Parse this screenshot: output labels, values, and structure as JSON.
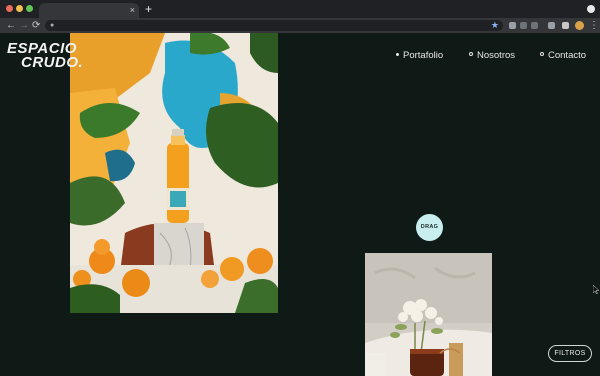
{
  "browser": {
    "tab_close": "×",
    "new_tab": "+",
    "back": "←",
    "forward": "→",
    "reload": "⟳",
    "star_icon": "star-icon"
  },
  "page": {
    "logo": {
      "line1": "ESPACIO",
      "line2": "CRUDO."
    },
    "nav": {
      "portafolio": "Portafolio",
      "nosotros": "Nosotros",
      "contacto": "Contacto"
    },
    "drag_label": "DRAG",
    "filtros_label": "FILTROS"
  },
  "colors": {
    "background": "#0f1a17",
    "drag_bg": "#c9eef0",
    "nav_text": "#e6e6e6"
  }
}
